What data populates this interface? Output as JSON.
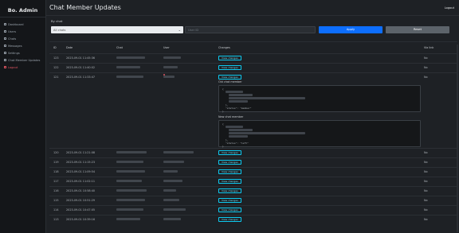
{
  "sidebar": {
    "brand": "Bo. Admin",
    "items": [
      {
        "label": "Dashboard"
      },
      {
        "label": "Users"
      },
      {
        "label": "Chats"
      },
      {
        "label": "Messages"
      },
      {
        "label": "Settings"
      },
      {
        "label": "Chat Member Updates"
      },
      {
        "label": "Logout",
        "danger": true
      }
    ]
  },
  "header": {
    "title": "Chat Member Updates",
    "logout_label": "Logout"
  },
  "filter": {
    "label": "By chat",
    "select_value": "All chats",
    "input_placeholder": "User ID",
    "apply_label": "Apply",
    "reset_label": "Reset"
  },
  "table": {
    "columns": [
      "ID",
      "Date",
      "Chat",
      "User",
      "Changes",
      "Via link"
    ],
    "view_label": "View changes",
    "rows": [
      {
        "id": "123",
        "date": "2023-09-01 11:45:36",
        "via": "No"
      },
      {
        "id": "122",
        "date": "2023-09-01 11:40:02",
        "via": "No"
      },
      {
        "id": "121",
        "date": "2023-09-01 11:33:47",
        "via": "No"
      },
      {
        "id": "120",
        "date": "2023-09-01 11:21:08",
        "via": "No"
      },
      {
        "id": "119",
        "date": "2023-09-01 11:15:23",
        "via": "No"
      },
      {
        "id": "118",
        "date": "2023-09-01 11:09:54",
        "via": "No"
      },
      {
        "id": "117",
        "date": "2023-09-01 11:02:11",
        "via": "No"
      },
      {
        "id": "116",
        "date": "2023-09-01 10:58:40",
        "via": "No"
      },
      {
        "id": "115",
        "date": "2023-09-01 10:51:29",
        "via": "No"
      },
      {
        "id": "114",
        "date": "2023-09-01 10:47:05",
        "via": "No"
      },
      {
        "id": "113",
        "date": "2023-09-01 10:39:16",
        "via": "No"
      }
    ],
    "old_label": "Old chat member",
    "new_label": "New chat member",
    "old_status": "\"status\": \"member\"",
    "new_status": "\"status\": \"left\""
  },
  "colors": {
    "accent": "#0d6efd",
    "info": "#0dcaf0",
    "danger": "#e05561"
  }
}
